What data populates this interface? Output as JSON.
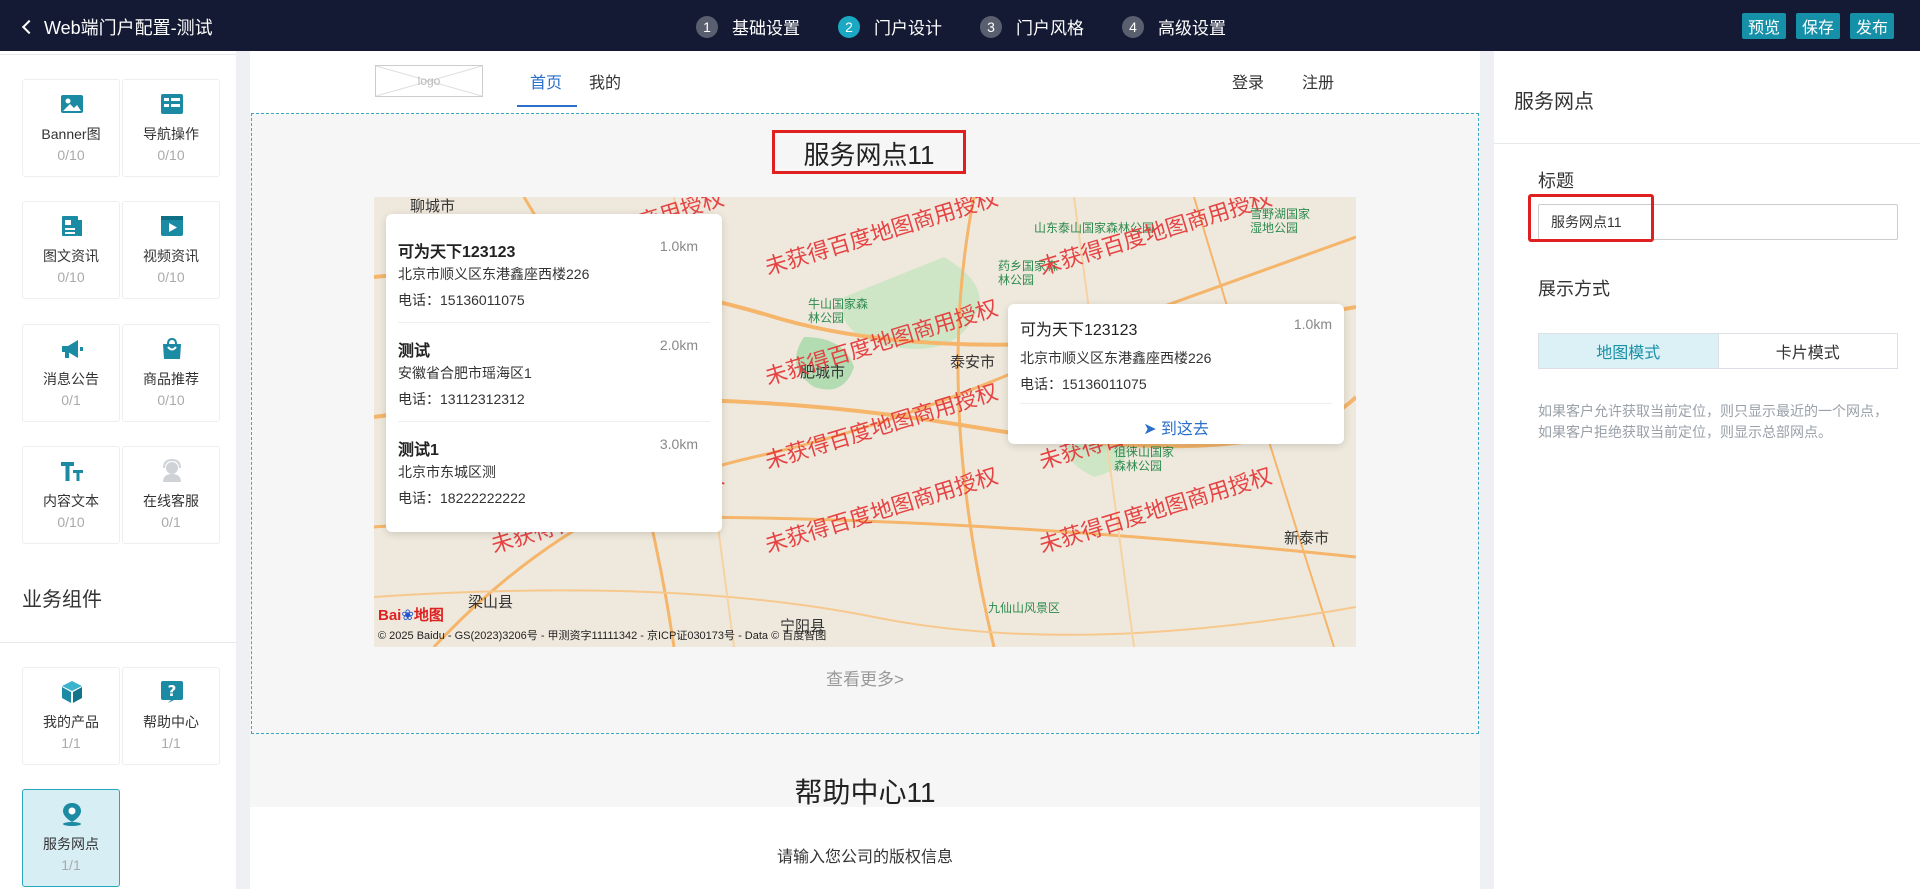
{
  "header": {
    "back_title": "Web端门户配置-测试",
    "steps": [
      {
        "num": "1",
        "label": "基础设置"
      },
      {
        "num": "2",
        "label": "门户设计"
      },
      {
        "num": "3",
        "label": "门户风格"
      },
      {
        "num": "4",
        "label": "高级设置"
      }
    ],
    "preview": "预览",
    "save": "保存",
    "publish": "发布"
  },
  "components": [
    {
      "name": "Banner图",
      "count": "0/10",
      "icon": "image-icon"
    },
    {
      "name": "导航操作",
      "count": "0/10",
      "icon": "nav-icon"
    },
    {
      "name": "图文资讯",
      "count": "0/10",
      "icon": "article-icon"
    },
    {
      "name": "视频资讯",
      "count": "0/10",
      "icon": "video-icon"
    },
    {
      "name": "消息公告",
      "count": "0/1",
      "icon": "megaphone-icon"
    },
    {
      "name": "商品推荐",
      "count": "0/10",
      "icon": "shopping-bag-icon"
    },
    {
      "name": "内容文本",
      "count": "0/10",
      "icon": "text-icon"
    },
    {
      "name": "在线客服",
      "count": "0/1",
      "icon": "customer-service-icon"
    }
  ],
  "business_title": "业务组件",
  "business_components": [
    {
      "name": "我的产品",
      "count": "1/1",
      "icon": "cube-icon"
    },
    {
      "name": "帮助中心",
      "count": "1/1",
      "icon": "help-icon"
    },
    {
      "name": "服务网点",
      "count": "1/1",
      "icon": "location-icon"
    }
  ],
  "canvas": {
    "logo": "logo",
    "nav": [
      "首页",
      "我的"
    ],
    "login": "登录",
    "register": "注册",
    "section_title": "服务网点11",
    "more": "查看更多>",
    "help_title": "帮助中心11",
    "footer": "请输入您公司的版权信息"
  },
  "map": {
    "watermark": "未获得百度地图商用授权",
    "cities": [
      "聊城市",
      "泰安市",
      "肥城市",
      "梁山县",
      "宁阳县",
      "新泰市"
    ],
    "pois": [
      "山东泰山国家森林公园",
      "药乡国家森林公园",
      "牛山国家森林公园",
      "徂徕山国家森林公园",
      "九仙山风景区",
      "雪野湖国家湿地公园"
    ],
    "copyright": "© 2025 Baidu - GS(2023)3206号 - 甲测资字11111342 - 京ICP证030173号 - Data © 百度智图",
    "logo_text": "Bai",
    "logo_text2": "地图",
    "list": [
      {
        "name": "可为天下123123",
        "distance": "1.0km",
        "address": "北京市顺义区东港鑫座西楼226",
        "phone": "电话：15136011075"
      },
      {
        "name": "测试",
        "distance": "2.0km",
        "address": "安徽省合肥市瑶海区1",
        "phone": "电话：13112312312"
      },
      {
        "name": "测试1",
        "distance": "3.0km",
        "address": "北京市东城区测",
        "phone": "电话：18222222222"
      }
    ],
    "popup": {
      "name": "可为天下123123",
      "distance": "1.0km",
      "address": "北京市顺义区东港鑫座西楼226",
      "phone": "电话：15136011075",
      "go": "到这去"
    }
  },
  "right_panel": {
    "title": "服务网点",
    "label_title": "标题",
    "title_value": "服务网点11",
    "label_display": "展示方式",
    "modes": [
      "地图模式",
      "卡片模式"
    ],
    "hint": "如果客户允许获取当前定位，则只显示最近的一个网点，如果客户拒绝获取当前定位，则显示总部网点。"
  },
  "colors": {
    "topbar": "#141a33",
    "accent": "#1590a8",
    "link": "#2a6fc9",
    "highlight": "#e02020"
  }
}
